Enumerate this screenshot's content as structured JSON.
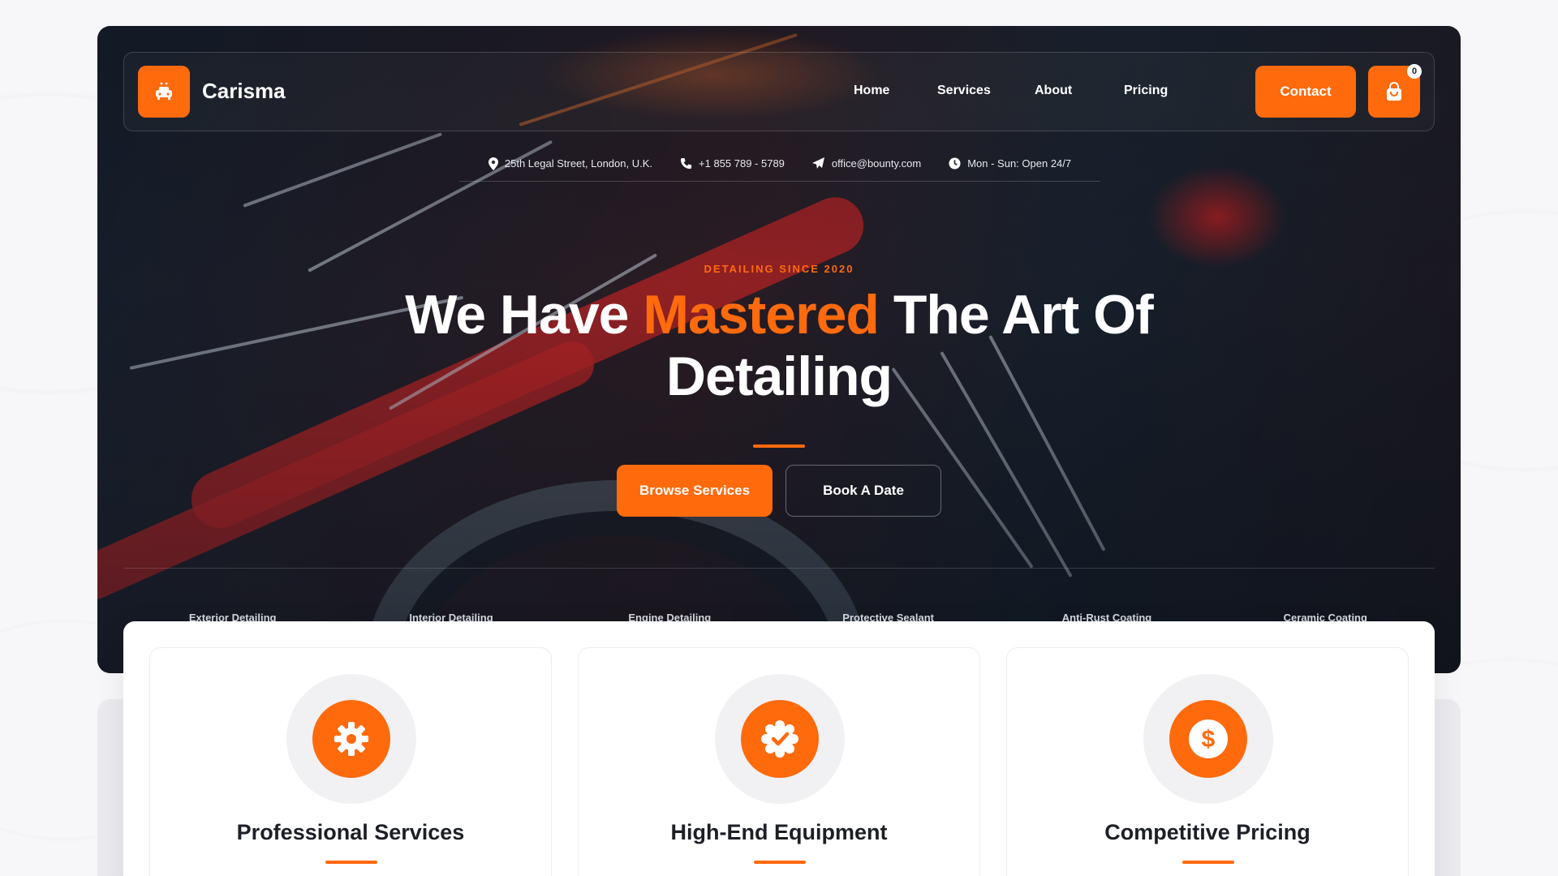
{
  "brand": {
    "name": "Carisma",
    "logo_icon": "car-wash-icon",
    "accent_color": "#ff6a0d"
  },
  "nav": {
    "links": [
      "Home",
      "Services",
      "About",
      "Pricing"
    ],
    "contact_label": "Contact",
    "cart_count": "0",
    "cart_icon": "shopping-bag-icon"
  },
  "info": {
    "address": "25th Legal Street, London, U.K.",
    "phone": "+1 855 789 - 5789",
    "email": "office@bounty.com",
    "hours": "Mon - Sun: Open 24/7"
  },
  "hero": {
    "eyebrow": "DETAILING SINCE 2020",
    "headline_part1": "We Have ",
    "headline_accent": "Mastered",
    "headline_part2": " The Art Of Detailing",
    "primary_button": "Browse Services",
    "secondary_button": "Book A Date"
  },
  "service_strip": [
    "Exterior Detailing",
    "Interior Detailing",
    "Engine Detailing",
    "Protective Sealant",
    "Anti-Rust Coating",
    "Ceramic Coating"
  ],
  "features": [
    {
      "title": "Professional Services",
      "icon": "gear-icon"
    },
    {
      "title": "High-End Equipment",
      "icon": "badge-check-icon"
    },
    {
      "title": "Competitive Pricing",
      "icon": "dollar-icon"
    }
  ]
}
